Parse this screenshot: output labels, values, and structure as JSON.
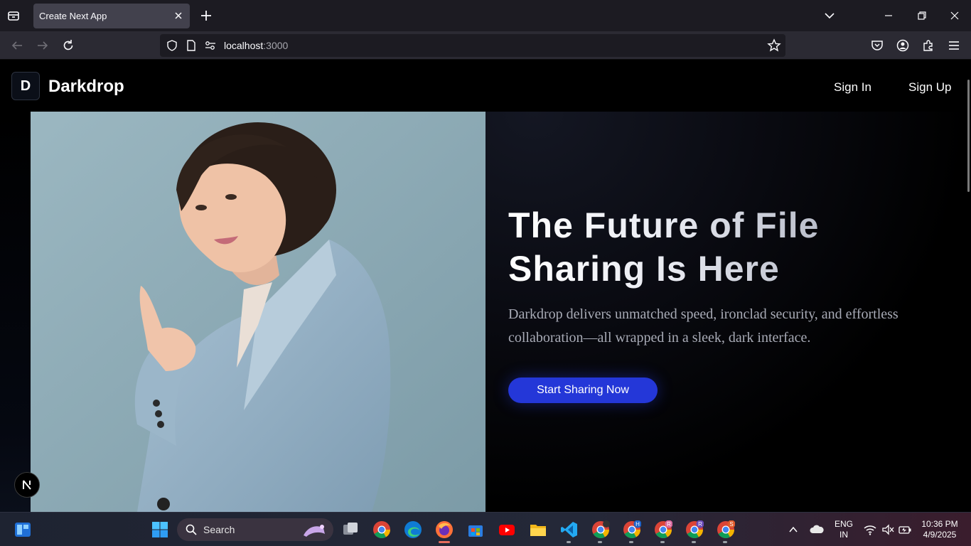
{
  "browser": {
    "tab_title": "Create Next App",
    "url_host": "localhost",
    "url_port": ":3000"
  },
  "site": {
    "logo_letter": "D",
    "brand": "Darkdrop",
    "nav": {
      "sign_in": "Sign In",
      "sign_up": "Sign Up"
    }
  },
  "hero": {
    "headline_line1": "The Future of File",
    "headline_line2": "Sharing Is Here",
    "subtitle": "Darkdrop delivers unmatched speed, ironclad security, and effortless collaboration—all wrapped in a sleek, dark interface.",
    "cta": "Start Sharing Now",
    "accent_color": "#2437d8"
  },
  "next_badge": "N",
  "taskbar": {
    "search_label": "Search",
    "lang_line1": "ENG",
    "lang_line2": "IN",
    "time": "10:36 PM",
    "date": "4/9/2025",
    "profile_badges": [
      "H",
      "R",
      "R",
      "S"
    ]
  }
}
